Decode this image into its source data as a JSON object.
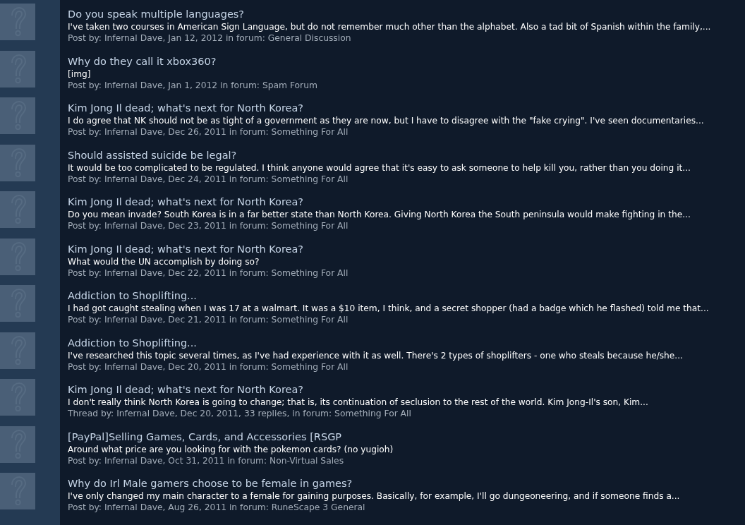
{
  "posts": [
    {
      "title": "Do you speak multiple languages?",
      "snippet": "I've taken two courses in American Sign Language, but do not remember much other than the alphabet. Also a tad bit of Spanish within the family,...",
      "meta": "Post by: Infernal Dave, Jan 12, 2012 in forum: General Discussion"
    },
    {
      "title": "Why do they call it xbox360?",
      "snippet": "[img]",
      "meta": "Post by: Infernal Dave, Jan 1, 2012 in forum: Spam Forum"
    },
    {
      "title": "Kim Jong Il dead; what's next for North Korea?",
      "snippet": "I do agree that NK should not be as tight of a government as they are now, but I have to disagree with the \"fake crying\". I've seen documentaries...",
      "meta": "Post by: Infernal Dave, Dec 26, 2011 in forum: Something For All"
    },
    {
      "title": "Should assisted suicide be legal?",
      "snippet": "It would be too complicated to be regulated. I think anyone would agree that it's easy to ask someone to help kill you, rather than you doing it...",
      "meta": "Post by: Infernal Dave, Dec 24, 2011 in forum: Something For All"
    },
    {
      "title": "Kim Jong Il dead; what's next for North Korea?",
      "snippet": "Do you mean invade? South Korea is in a far better state than North Korea. Giving North Korea the South peninsula would make fighting in the...",
      "meta": "Post by: Infernal Dave, Dec 23, 2011 in forum: Something For All"
    },
    {
      "title": "Kim Jong Il dead; what's next for North Korea?",
      "snippet": "What would the UN accomplish by doing so?",
      "meta": "Post by: Infernal Dave, Dec 22, 2011 in forum: Something For All"
    },
    {
      "title": "Addiction to Shoplifting...",
      "snippet": "I had got caught stealing when I was 17 at a walmart. It was a $10 item, I think, and a secret shopper (had a badge which he flashed) told me that...",
      "meta": "Post by: Infernal Dave, Dec 21, 2011 in forum: Something For All"
    },
    {
      "title": "Addiction to Shoplifting...",
      "snippet": "I've researched this topic several times, as I've had experience with it as well. There's 2 types of shoplifters - one who steals because he/she...",
      "meta": "Post by: Infernal Dave, Dec 20, 2011 in forum: Something For All"
    },
    {
      "title": "Kim Jong Il dead; what's next for North Korea?",
      "snippet": "I don't really think North Korea is going to change; that is, its continuation of seclusion to the rest of the world. Kim Jong-Il's son, Kim...",
      "meta": "Thread by: Infernal Dave, Dec 20, 2011, 33 replies, in forum: Something For All"
    },
    {
      "title": "[PayPal]Selling Games, Cards, and Accessories [RSGP",
      "snippet": "Around what price are you looking for with the pokemon cards? (no yugioh)",
      "meta": "Post by: Infernal Dave, Oct 31, 2011 in forum: Non-Virtual Sales"
    },
    {
      "title": "Why do Irl Male gamers choose to be female in games?",
      "snippet": "I've only changed my main character to a female for gaining purposes. Basically, for example, I'll go dungeoneering, and if someone finds a...",
      "meta": "Post by: Infernal Dave, Aug 26, 2011 in forum: RuneScape 3 General"
    }
  ]
}
